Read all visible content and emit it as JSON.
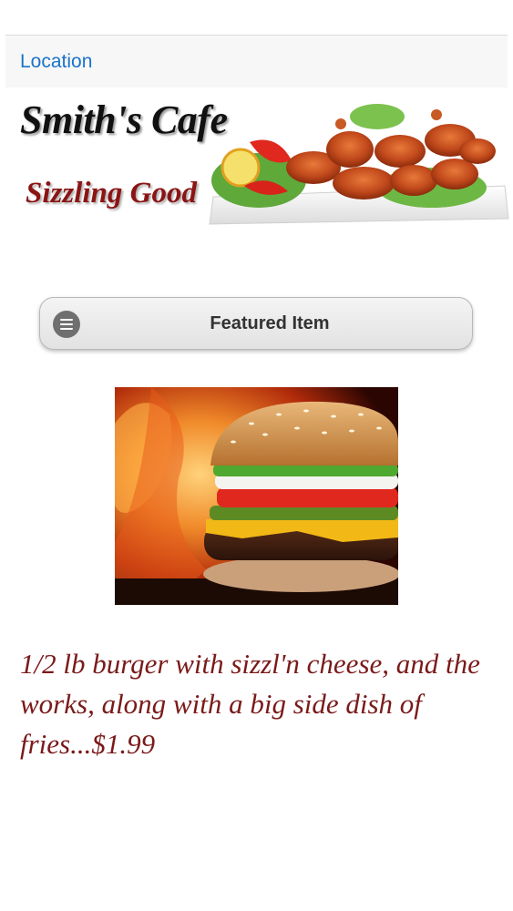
{
  "nav": {
    "location_label": "Location"
  },
  "banner": {
    "title": "Smith's Cafe",
    "tagline": "Sizzling Good",
    "photo_icon": "chicken-wings-photo"
  },
  "featured": {
    "button_label": "Featured Item",
    "button_icon": "menu-list-icon",
    "image_icon": "burger-photo",
    "description": "1/2 lb burger with sizzl'n cheese, and the works, along with a big side dish of fries...$1.99"
  },
  "colors": {
    "link": "#1a73c9",
    "tagline": "#8b1414",
    "description": "#7a1a1a",
    "button_icon_bg": "#6f6f6f"
  }
}
